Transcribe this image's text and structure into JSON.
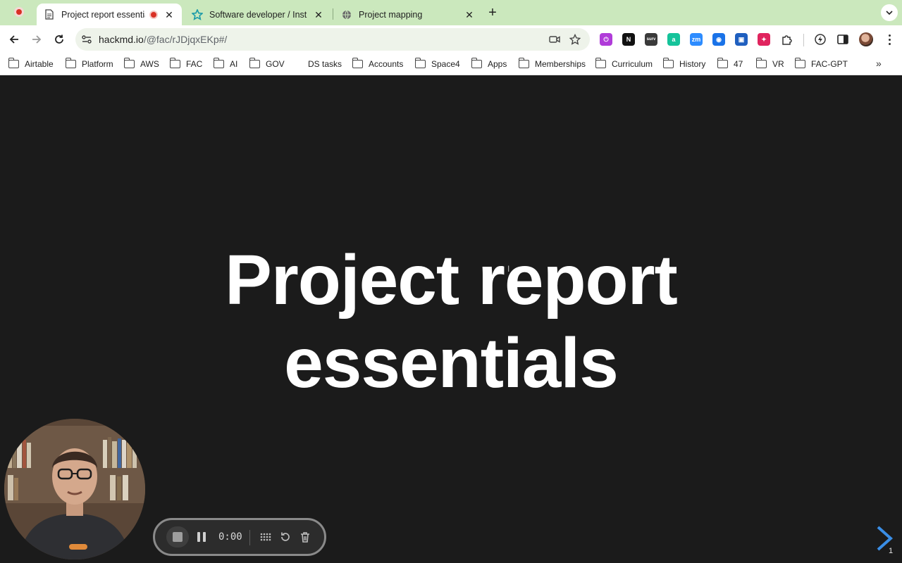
{
  "browser": {
    "tabs": [
      {
        "title": "Project report essentials",
        "active": true,
        "recording": true,
        "favicon": "document-icon"
      },
      {
        "title": "Software developer / Institute",
        "active": false,
        "favicon": "star-icon"
      },
      {
        "title": "Project mapping",
        "active": false,
        "favicon": "globe-icon"
      }
    ],
    "url_host": "hackmd.io",
    "url_path": "/@fac/rJDjqxEKp#/",
    "bookmarks": [
      {
        "label": "Airtable",
        "folder": true
      },
      {
        "label": "Platform",
        "folder": true
      },
      {
        "label": "AWS",
        "folder": true
      },
      {
        "label": "FAC",
        "folder": true
      },
      {
        "label": "AI",
        "folder": true
      },
      {
        "label": "GOV",
        "folder": true
      },
      {
        "label": "DS tasks",
        "folder": false
      },
      {
        "label": "Accounts",
        "folder": true
      },
      {
        "label": "Space4",
        "folder": true
      },
      {
        "label": "Apps",
        "folder": true
      },
      {
        "label": "Memberships",
        "folder": true
      },
      {
        "label": "Curriculum",
        "folder": true
      },
      {
        "label": "History",
        "folder": true
      },
      {
        "label": "47",
        "folder": true
      },
      {
        "label": "VR",
        "folder": true
      },
      {
        "label": "FAC-GPT",
        "folder": true
      }
    ],
    "extensions": [
      {
        "name": "extension-purple-icon",
        "color": "#b03cd9",
        "glyph": "⏻"
      },
      {
        "name": "notion-icon",
        "color": "#111111",
        "glyph": "N"
      },
      {
        "name": "surv-icon",
        "color": "#3a3a3a",
        "glyph": "surv"
      },
      {
        "name": "grammarly-icon",
        "color": "#15c39a",
        "glyph": "a"
      },
      {
        "name": "zoom-icon",
        "color": "#2d8cff",
        "glyph": "zm"
      },
      {
        "name": "password-manager-icon",
        "color": "#1a73e8",
        "glyph": "◉"
      },
      {
        "name": "screen-capture-icon",
        "color": "#1f5fbf",
        "glyph": "▣"
      },
      {
        "name": "vpn-icon",
        "color": "#e0245e",
        "glyph": "✦"
      }
    ]
  },
  "slide": {
    "title_line1": "Project report",
    "title_line2": "essentials",
    "page_number": "1"
  },
  "recorder": {
    "time": "0:00"
  },
  "colors": {
    "tab_strip": "#cbe8bd",
    "slide_background": "#1b1b1b",
    "next_arrow": "#3a8ee6",
    "record_red": "#d93025"
  }
}
